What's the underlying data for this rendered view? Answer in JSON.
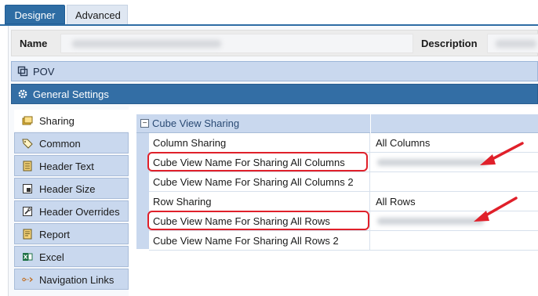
{
  "tabs": [
    {
      "label": "Designer",
      "active": true
    },
    {
      "label": "Advanced",
      "active": false
    }
  ],
  "header": {
    "name_label": "Name",
    "description_label": "Description"
  },
  "sections": {
    "pov": {
      "label": "POV",
      "icon": "pov-icon"
    },
    "general": {
      "label": "General Settings",
      "icon": "gear-icon"
    }
  },
  "nav": {
    "items": [
      {
        "label": "Sharing",
        "icon": "sharing-icon",
        "active": true
      },
      {
        "label": "Common",
        "icon": "tag-icon",
        "active": false
      },
      {
        "label": "Header Text",
        "icon": "header-text-icon",
        "active": false
      },
      {
        "label": "Header Size",
        "icon": "header-size-icon",
        "active": false
      },
      {
        "label": "Header Overrides",
        "icon": "wrench-icon",
        "active": false
      },
      {
        "label": "Report",
        "icon": "report-icon",
        "active": false
      },
      {
        "label": "Excel",
        "icon": "excel-icon",
        "active": false
      },
      {
        "label": "Navigation Links",
        "icon": "link-icon",
        "active": false
      }
    ]
  },
  "grid": {
    "group_title": "Cube View Sharing",
    "rows": [
      {
        "name": "Column Sharing",
        "value": "All Columns"
      },
      {
        "name": "Cube View Name For Sharing All Columns",
        "value": "",
        "highlighted": true
      },
      {
        "name": "Cube View Name For Sharing All Columns 2",
        "value": ""
      },
      {
        "name": "Row Sharing",
        "value": "All Rows"
      },
      {
        "name": "Cube View Name For Sharing All Rows",
        "value": "",
        "highlighted": true
      },
      {
        "name": "Cube View Name For Sharing All Rows 2",
        "value": ""
      }
    ]
  },
  "colors": {
    "accent": "#2e6da4",
    "section_bg": "#c9d8ee",
    "highlight": "#e0202a"
  }
}
